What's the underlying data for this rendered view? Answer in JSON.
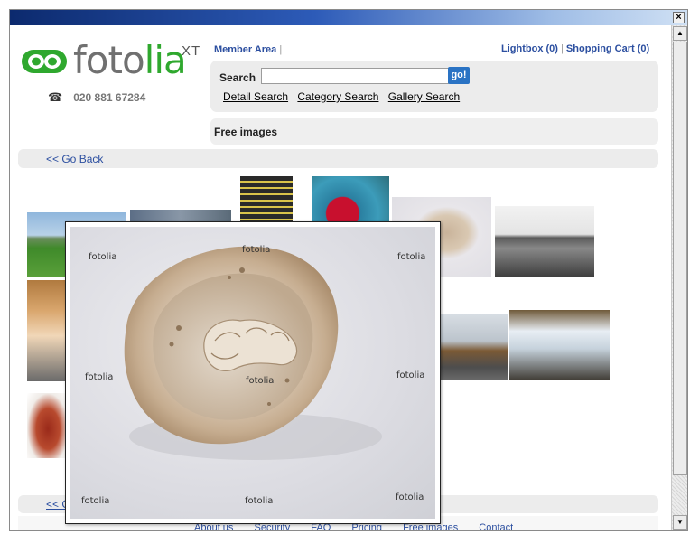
{
  "window": {
    "close_glyph": "×",
    "scroll_up_glyph": "▲",
    "scroll_down_glyph": "▼"
  },
  "header": {
    "logo_text_part1": "foto",
    "logo_text_part2": "lia",
    "logo_superscript": "XT",
    "phone_icon": "☎",
    "phone_number": "020 881 67284",
    "member_area": "Member Area",
    "member_sep": "|",
    "lightbox": "Lightbox (0)",
    "cart_sep": "|",
    "shopping_cart": "Shopping Cart (0)"
  },
  "search": {
    "label": "Search",
    "input_value": "",
    "go_label": "go!",
    "links": [
      "Detail Search",
      "Category Search",
      "Gallery Search"
    ]
  },
  "section": {
    "title": "Free images"
  },
  "nav": {
    "go_back": "<< Go Back",
    "go_back_bottom": "<< G"
  },
  "preview": {
    "watermarks": [
      "fotolia",
      "fotolia",
      "fotolia",
      "fotolia",
      "fotolia",
      "fotolia",
      "fotolia",
      "fotolia",
      "fotolia"
    ]
  },
  "footer": {
    "links": [
      "About us",
      "Security",
      "FAQ",
      "Pricing",
      "Free images",
      "Contact"
    ]
  },
  "colors": {
    "link_blue": "#2c4fa0",
    "logo_green": "#2fa82e",
    "go_button": "#2a73c4",
    "panel_gray": "#ececec"
  }
}
